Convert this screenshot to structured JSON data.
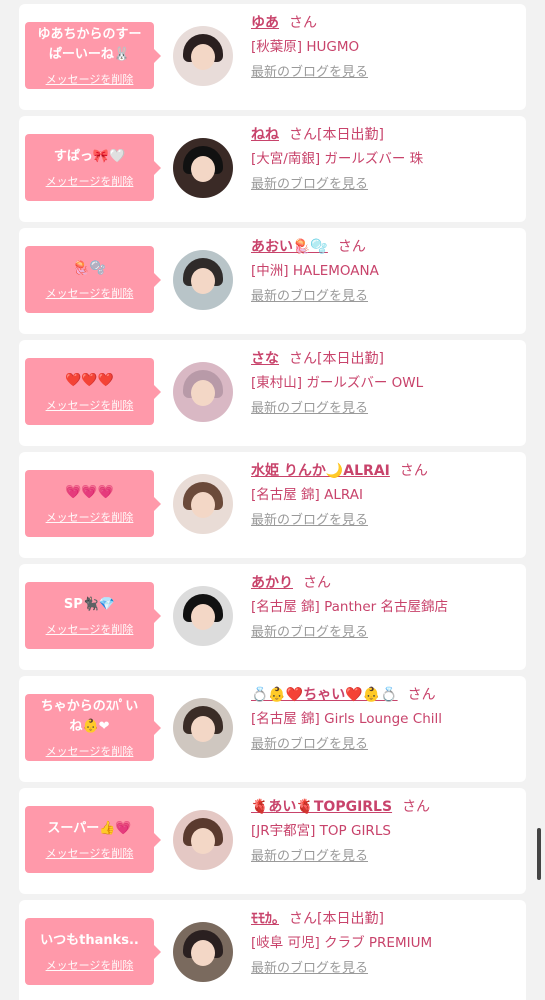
{
  "delete_label": "メッセージを削除",
  "blog_label": "最新のブログを見る",
  "cards": [
    {
      "message": "ゆあちからのすー\nぱーいーね🐰",
      "name": "ゆあ",
      "san": "さん",
      "tag": "",
      "shop": "[秋葉原] HUGMO",
      "avatar_bg": "#e8dcd9",
      "hair": "#2a1f1f"
    },
    {
      "message": "すぱっ🎀🤍",
      "name": "ねね",
      "san": "さん",
      "tag": "[本日出勤]",
      "shop": "[大宮/南銀] ガールズバー 珠",
      "avatar_bg": "#3a2a26",
      "hair": "#111111"
    },
    {
      "message": "🪼🫧",
      "name": "あおい🪼🫧",
      "san": "さん",
      "tag": "",
      "shop": "[中洲] HALEMOANA",
      "avatar_bg": "#b8c4c8",
      "hair": "#2f2b2a"
    },
    {
      "message": "❤️❤️❤️",
      "name": "さな",
      "san": "さん",
      "tag": "[本日出勤]",
      "shop": "[東村山] ガールズバー OWL",
      "avatar_bg": "#d9b8c4",
      "hair": "#b89aa8"
    },
    {
      "message": "💗💗💗",
      "name": "水姫 りんか🌙ALRAI",
      "san": "さん",
      "tag": "",
      "shop": "[名古屋 錦] ALRAI",
      "avatar_bg": "#e9dcd6",
      "hair": "#6b4a3a"
    },
    {
      "message": "SP🐈‍⬛💎",
      "name": "あかり",
      "san": "さん",
      "tag": "",
      "shop": "[名古屋 錦] Panther 名古屋錦店",
      "avatar_bg": "#dcdcdc",
      "hair": "#111111"
    },
    {
      "message": "ちゃからのｽﾊﾟい\nね👶❤",
      "name": "💍👶❤️ちゃい❤️👶💍",
      "san": "さん",
      "tag": "",
      "shop": "[名古屋 錦] Girls Lounge Chill",
      "avatar_bg": "#cfc7c0",
      "hair": "#3a2c26"
    },
    {
      "message": "スーパー👍💗",
      "name": "🫀あい🫀TOPGIRLS",
      "san": "さん",
      "tag": "",
      "shop": "[JR宇都宮] TOP GIRLS",
      "avatar_bg": "#e4c8c4",
      "hair": "#5a3a2e"
    },
    {
      "message": "いつもthanks..",
      "name": "ﾓﾓｶ｡",
      "san": "さん",
      "tag": "[本日出勤]",
      "shop": "[岐阜 可児] クラブ PREMIUM",
      "avatar_bg": "#7a6a5e",
      "hair": "#2a2020"
    }
  ]
}
